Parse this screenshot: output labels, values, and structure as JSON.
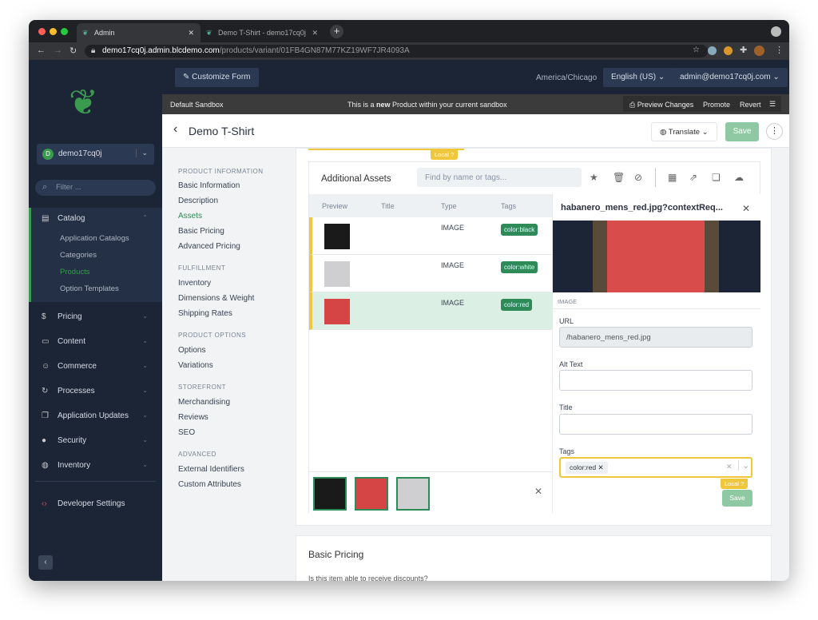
{
  "browser": {
    "tabs": [
      {
        "title": "Admin"
      },
      {
        "title": "Demo T-Shirt - demo17cq0j"
      }
    ],
    "url_host": "demo17cq0j.admin.blcdemo.com",
    "url_path": "/products/variant/01FB4GN87M77KZ19WF7JR4093A"
  },
  "header": {
    "customize_form": "Customize Form",
    "timezone": "America/Chicago",
    "locale": "English (US)",
    "user": "admin@demo17cq0j.com"
  },
  "sandbox": {
    "name": "Default Sandbox",
    "msg_pre": "This is a ",
    "msg_bold": "new",
    "msg_post": " Product within your current sandbox",
    "preview": "Preview Changes",
    "promote": "Promote",
    "revert": "Revert"
  },
  "sidebar": {
    "tenant": "demo17cq0j",
    "tenant_initial": "D",
    "filter_placeholder": "Filter ...",
    "catalog": "Catalog",
    "catalog_items": [
      "Application Catalogs",
      "Categories",
      "Products",
      "Option Templates"
    ],
    "items": [
      "Pricing",
      "Content",
      "Commerce",
      "Processes",
      "Application Updates",
      "Security",
      "Inventory"
    ],
    "dev": "Developer Settings"
  },
  "page": {
    "title": "Demo T-Shirt",
    "translate": "Translate",
    "save": "Save"
  },
  "leftnav": {
    "sections": [
      {
        "title": "PRODUCT INFORMATION",
        "items": [
          "Basic Information",
          "Description",
          "Assets",
          "Basic Pricing",
          "Advanced Pricing"
        ]
      },
      {
        "title": "FULFILLMENT",
        "items": [
          "Inventory",
          "Dimensions & Weight",
          "Shipping Rates"
        ]
      },
      {
        "title": "PRODUCT OPTIONS",
        "items": [
          "Options",
          "Variations"
        ]
      },
      {
        "title": "STOREFRONT",
        "items": [
          "Merchandising",
          "Reviews",
          "SEO"
        ]
      },
      {
        "title": "ADVANCED",
        "items": [
          "External Identifiers",
          "Custom Attributes"
        ]
      }
    ],
    "active": "Assets"
  },
  "assets": {
    "local": "Local",
    "title": "Additional Assets",
    "search_placeholder": "Find by name or tags...",
    "columns": [
      "Preview",
      "Title",
      "Type",
      "Tags"
    ],
    "rows": [
      {
        "type": "IMAGE",
        "tag": "color:black",
        "shirt": "#1a1a1a"
      },
      {
        "type": "IMAGE",
        "tag": "color:white",
        "shirt": "#cfcfd2"
      },
      {
        "type": "IMAGE",
        "tag": "color:red",
        "shirt": "#d64545"
      }
    ]
  },
  "detail": {
    "filename": "habanero_mens_red.jpg?contextReq...",
    "kind": "IMAGE",
    "url_label": "URL",
    "url_value": "/habanero_mens_red.jpg",
    "alt_label": "Alt Text",
    "title_label": "Title",
    "tags_label": "Tags",
    "tag_value": "color:red",
    "local": "Local",
    "save": "Save"
  },
  "pricing": {
    "title": "Basic Pricing",
    "question": "Is this item able to receive discounts?"
  },
  "colors": {
    "sidebar": "#1c2535",
    "accent": "#2e8b57",
    "local": "#f0c63a",
    "selected_row": "#dcefe4"
  }
}
